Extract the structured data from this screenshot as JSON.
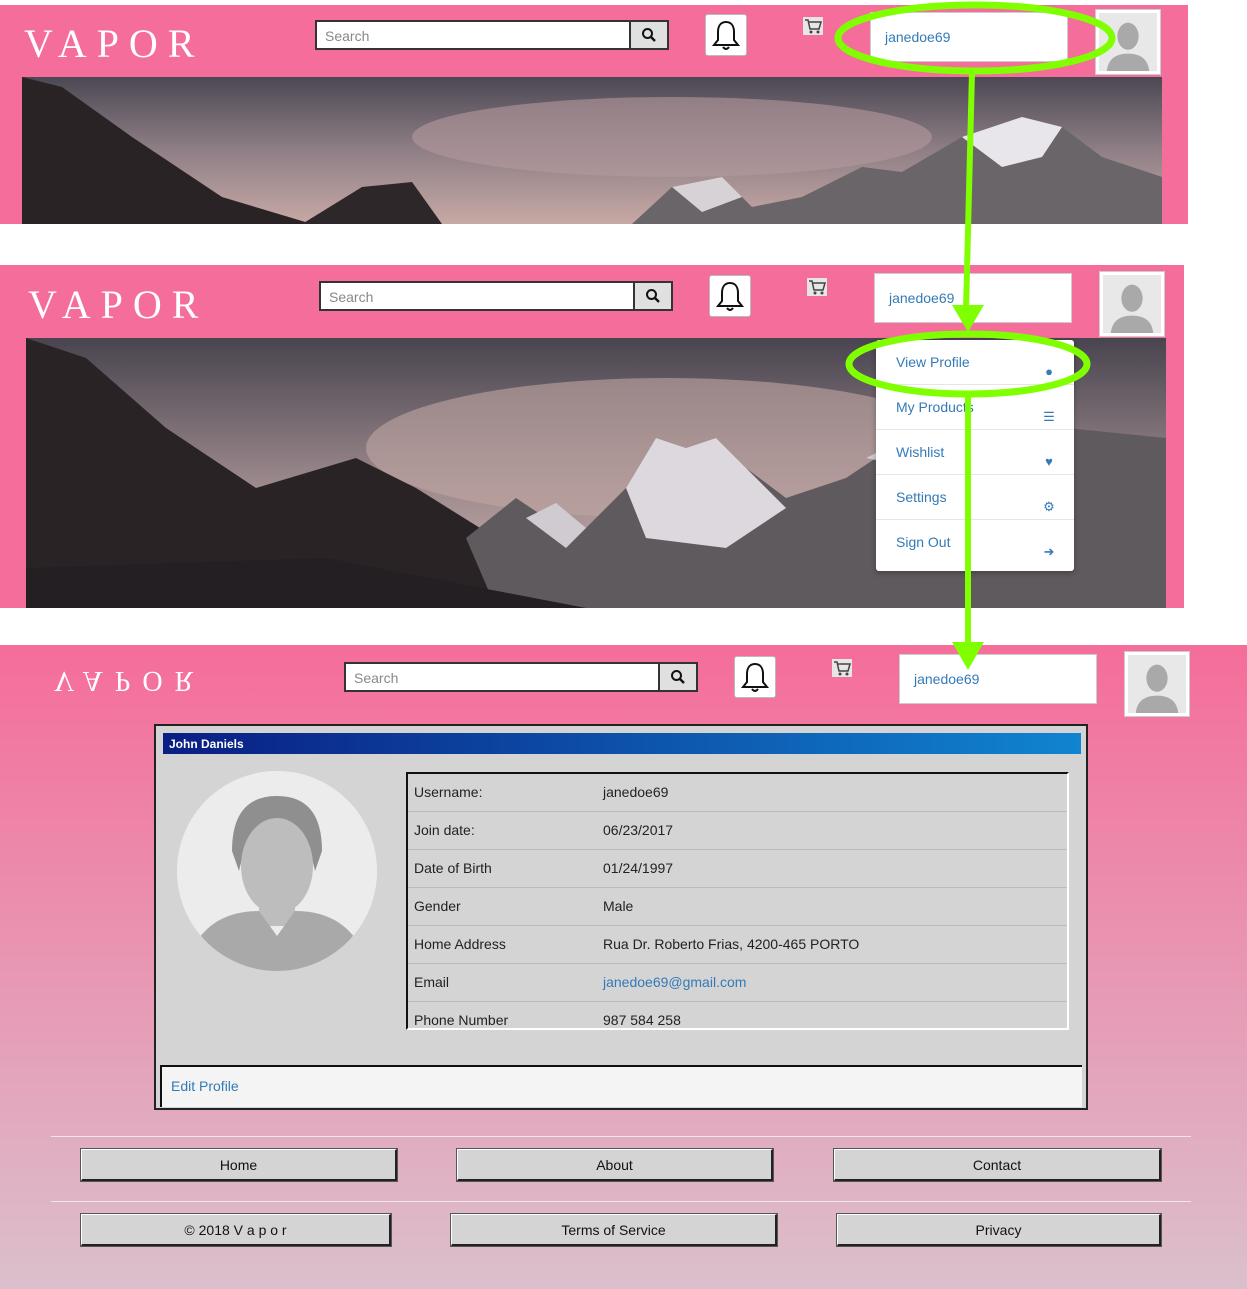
{
  "brand": {
    "logo": "VAPOR",
    "logo_flipped": "VAPOR"
  },
  "header": {
    "search_placeholder": "Search",
    "username": "janedoe69"
  },
  "dropdown": {
    "items": [
      {
        "label": "View Profile",
        "icon": "user-icon"
      },
      {
        "label": "My Products",
        "icon": "list-icon"
      },
      {
        "label": "Wishlist",
        "icon": "heart-icon"
      },
      {
        "label": "Settings",
        "icon": "gear-icon"
      },
      {
        "label": "Sign Out",
        "icon": "sign-out-icon"
      }
    ]
  },
  "profile": {
    "title": "John Daniels",
    "fields": [
      {
        "label": "Username:",
        "value": "janedoe69"
      },
      {
        "label": "Join date:",
        "value": "06/23/2017"
      },
      {
        "label": "Date of Birth",
        "value": "01/24/1997"
      },
      {
        "label": "Gender",
        "value": "Male"
      },
      {
        "label": "Home Address",
        "value": "Rua Dr. Roberto Frias, 4200-465 PORTO"
      },
      {
        "label": "Email",
        "value": "janedoe69@gmail.com"
      },
      {
        "label": "Phone Number",
        "value": "987 584 258"
      }
    ],
    "edit_label": "Edit Profile"
  },
  "footer": {
    "home": "Home",
    "about": "About",
    "contact": "Contact",
    "copyright": "© 2018 V a p o r",
    "terms": "Terms of Service",
    "privacy": "Privacy"
  },
  "colors": {
    "header_pink": "#f56d9a",
    "highlight_green": "#7fff00",
    "link_blue": "#337ab7"
  }
}
